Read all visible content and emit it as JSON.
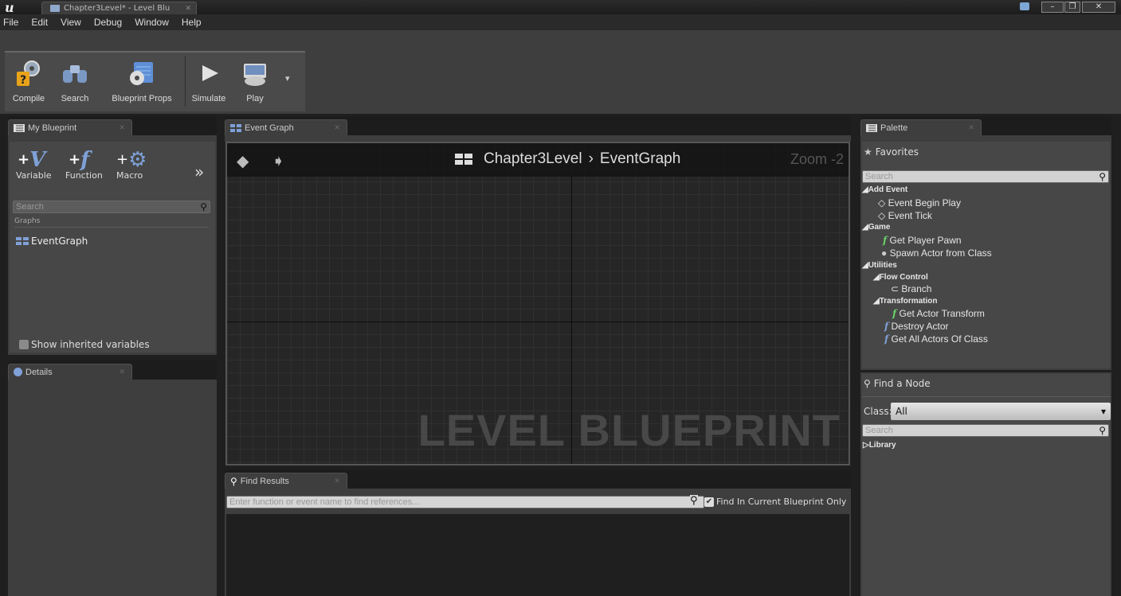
{
  "window": {
    "tab_title": "Chapter3Level* - Level Blu",
    "minimize": "–",
    "maximize": "❐",
    "close": "✕"
  },
  "menu": [
    "File",
    "Edit",
    "View",
    "Debug",
    "Window",
    "Help"
  ],
  "toolbar": {
    "compile": "Compile",
    "search": "Search",
    "blueprint_props": "Blueprint Props",
    "simulate": "Simulate",
    "play": "Play"
  },
  "my_blueprint": {
    "tab": "My Blueprint",
    "variable": "Variable",
    "function": "Function",
    "macro": "Macro",
    "search_placeholder": "Search",
    "graphs_label": "Graphs",
    "event_graph": "EventGraph",
    "show_inherited": "Show inherited variables"
  },
  "details": {
    "tab": "Details"
  },
  "event_graph": {
    "tab": "Event Graph",
    "breadcrumb_level": "Chapter3Level",
    "breadcrumb_sep": "›",
    "breadcrumb_graph": "EventGraph",
    "zoom": "Zoom -2",
    "watermark": "LEVEL BLUEPRINT"
  },
  "find_results": {
    "tab": "Find Results",
    "placeholder": "Enter function or event name to find references...",
    "checkbox_label": "Find In Current Blueprint Only"
  },
  "palette": {
    "tab": "Palette",
    "favorites": "Favorites",
    "search_placeholder": "Search",
    "tree": {
      "add_event": "Add Event",
      "event_begin_play": "Event Begin Play",
      "event_tick": "Event Tick",
      "game": "Game",
      "get_player_pawn": "Get Player Pawn",
      "spawn_actor": "Spawn Actor from Class",
      "utilities": "Utilities",
      "flow_control": "Flow Control",
      "branch": "Branch",
      "transformation": "Transformation",
      "get_actor_transform": "Get Actor Transform",
      "destroy_actor": "Destroy Actor",
      "get_all_actors": "Get All Actors Of Class"
    },
    "find_a_node": "Find a Node",
    "class_label": "Class:",
    "class_value": "All",
    "node_search_placeholder": "Search",
    "library": "Library"
  }
}
